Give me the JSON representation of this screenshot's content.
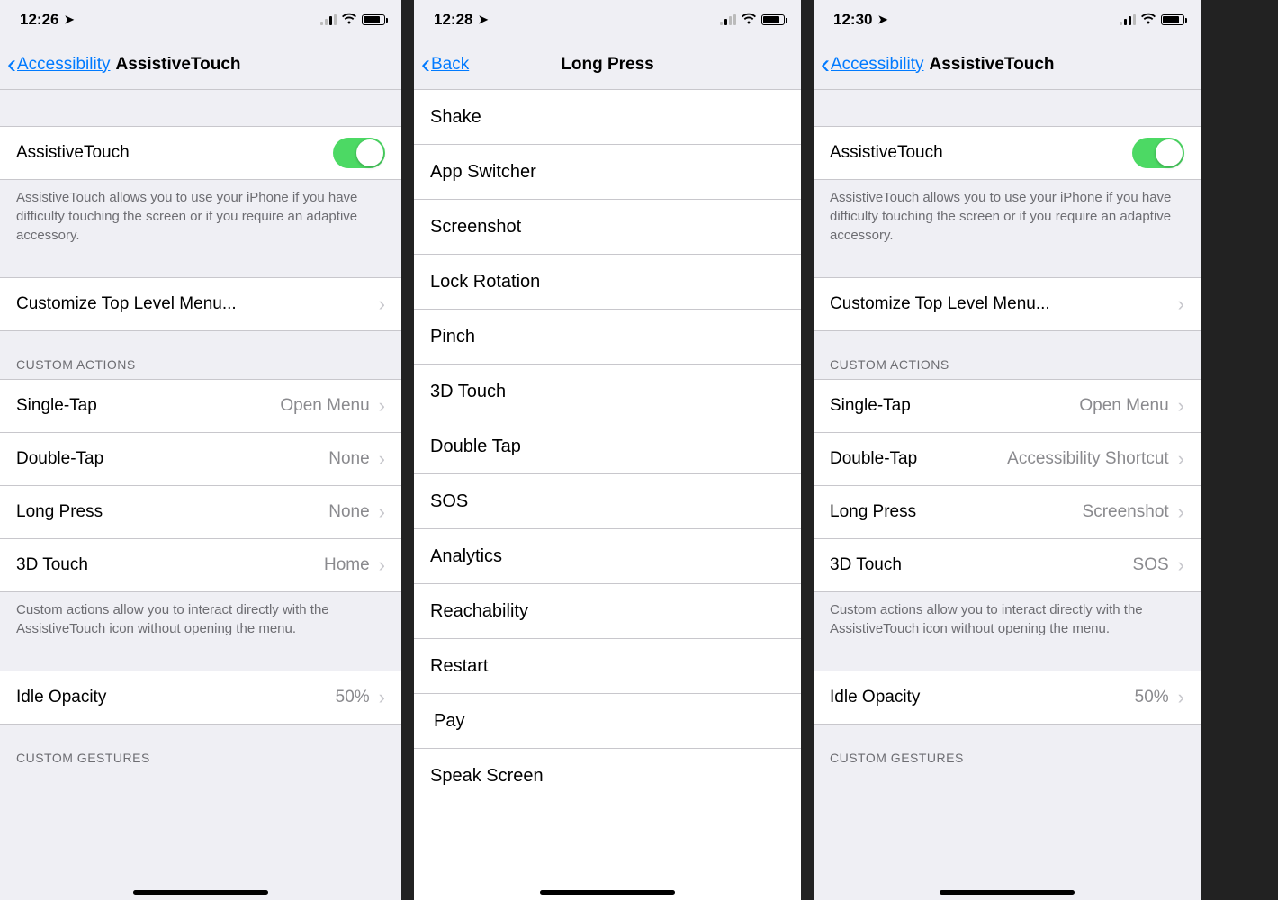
{
  "screens": {
    "a": {
      "time": "12:26",
      "back": "Accessibility",
      "title": "AssistiveTouch",
      "toggle_label": "AssistiveTouch",
      "desc": "AssistiveTouch allows you to use your iPhone if you have difficulty touching the screen or if you require an adaptive accessory.",
      "customize": "Customize Top Level Menu...",
      "custom_actions_header": "CUSTOM ACTIONS",
      "actions": {
        "single_tap": {
          "label": "Single-Tap",
          "value": "Open Menu"
        },
        "double_tap": {
          "label": "Double-Tap",
          "value": "None"
        },
        "long_press": {
          "label": "Long Press",
          "value": "None"
        },
        "threed": {
          "label": "3D Touch",
          "value": "Home"
        }
      },
      "actions_footer": "Custom actions allow you to interact directly with the AssistiveTouch icon without opening the menu.",
      "idle_label": "Idle Opacity",
      "idle_value": "50%",
      "gestures_header": "CUSTOM GESTURES"
    },
    "b": {
      "time": "12:28",
      "back": "Back",
      "title": "Long Press",
      "options": [
        "Shake",
        "App Switcher",
        "Screenshot",
        "Lock Rotation",
        "Pinch",
        "3D Touch",
        "Double Tap",
        "SOS",
        "Analytics",
        "Reachability",
        "Restart",
        "Pay",
        "Speak Screen"
      ]
    },
    "c": {
      "time": "12:30",
      "back": "Accessibility",
      "title": "AssistiveTouch",
      "toggle_label": "AssistiveTouch",
      "desc": "AssistiveTouch allows you to use your iPhone if you have difficulty touching the screen or if you require an adaptive accessory.",
      "customize": "Customize Top Level Menu...",
      "custom_actions_header": "CUSTOM ACTIONS",
      "actions": {
        "single_tap": {
          "label": "Single-Tap",
          "value": "Open Menu"
        },
        "double_tap": {
          "label": "Double-Tap",
          "value": "Accessibility Shortcut"
        },
        "long_press": {
          "label": "Long Press",
          "value": "Screenshot"
        },
        "threed": {
          "label": "3D Touch",
          "value": "SOS"
        }
      },
      "actions_footer": "Custom actions allow you to interact directly with the AssistiveTouch icon without opening the menu.",
      "idle_label": "Idle Opacity",
      "idle_value": "50%",
      "gestures_header": "CUSTOM GESTURES"
    }
  }
}
